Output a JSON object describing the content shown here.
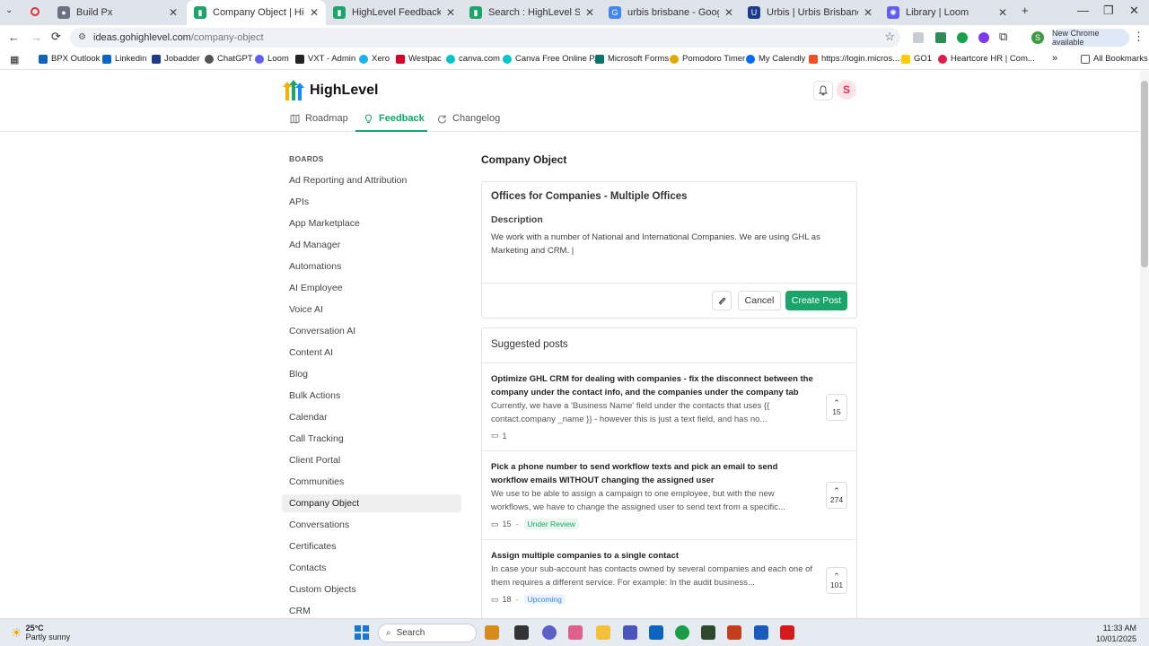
{
  "browser": {
    "tabs": [
      {
        "title": "Build Px",
        "color": "#6b7280"
      },
      {
        "title": "Company Object | HighLevel",
        "color": "#1aa56a"
      },
      {
        "title": "HighLevel Feedback",
        "color": "#1aa56a"
      },
      {
        "title": "Search : HighLevel Support Po",
        "color": "#1aa56a"
      },
      {
        "title": "urbis brisbane - Google Search",
        "color": "#4285f4"
      },
      {
        "title": "Urbis | Urbis Brisbane Design",
        "color": "#1a3b8c"
      },
      {
        "title": "Library | Loom",
        "color": "#625df5"
      }
    ],
    "url_host": "ideas.gohighlevel.com",
    "url_path": "/company-object",
    "new_chrome": "New Chrome available",
    "profile_initial": "S",
    "bookmarks": [
      "BPX Outlook",
      "Linkedin",
      "Jobadder",
      "ChatGPT",
      "Loom",
      "VXT - Admin",
      "Xero",
      "Westpac",
      "canva.com",
      "Canva Free Online P...",
      "Microsoft Forms",
      "Pomodoro Timer",
      "My Calendly",
      "https://login.micros...",
      "GO1",
      "Heartcore HR | Com..."
    ],
    "all_bookmarks": "All Bookmarks"
  },
  "app": {
    "brand": "HighLevel",
    "avatar_initial": "S",
    "nav": {
      "roadmap": "Roadmap",
      "feedback": "Feedback",
      "changelog": "Changelog"
    }
  },
  "sidebar": {
    "heading": "BOARDS",
    "boards": [
      "Ad Reporting and Attribution",
      "APIs",
      "App Marketplace",
      "Ad Manager",
      "Automations",
      "AI Employee",
      "Voice AI",
      "Conversation AI",
      "Content AI",
      "Blog",
      "Bulk Actions",
      "Calendar",
      "Call Tracking",
      "Client Portal",
      "Communities",
      "Company Object",
      "Conversations",
      "Certificates",
      "Contacts",
      "Custom Objects",
      "CRM"
    ],
    "active": "Company Object"
  },
  "main": {
    "board_title": "Company Object",
    "form": {
      "post_title": "Offices for Companies - Multiple Offices",
      "description_label": "Description",
      "description_text": "We work with a number of National and International Companies. We are using GHL as Marketing and CRM. |",
      "cancel_label": "Cancel",
      "create_label": "Create Post"
    },
    "suggested": {
      "heading": "Suggested posts",
      "posts": [
        {
          "title": "Optimize GHL CRM for dealing with companies - fix the disconnect between the company under the contact info, and the companies under the company tab",
          "excerpt": "Currently, we have a 'Business Name' field under the contacts that uses {{ contact.company _name }} - however this is just a text field, and has no...",
          "comments": "1",
          "status": "",
          "votes": "15"
        },
        {
          "title": "Pick a phone number to send workflow texts and pick an email to send workflow emails WITHOUT changing the assigned user",
          "excerpt": "We use to be able to assign a campaign to one employee, but with the new workflows, we have to change the assigned user to send text from a specific...",
          "comments": "15",
          "status": "Under Review",
          "votes": "274"
        },
        {
          "title": "Assign multiple companies to a single contact",
          "excerpt": "In case your sub-account has contacts owned by several companies and each one of them requires a different service. For example: In the audit business...",
          "comments": "18",
          "status": "Upcoming",
          "votes": "101"
        }
      ]
    }
  },
  "taskbar": {
    "temp": "25°C",
    "weather": "Partly sunny",
    "search": "Search",
    "time": "11:33 AM",
    "date": "10/01/2025"
  }
}
